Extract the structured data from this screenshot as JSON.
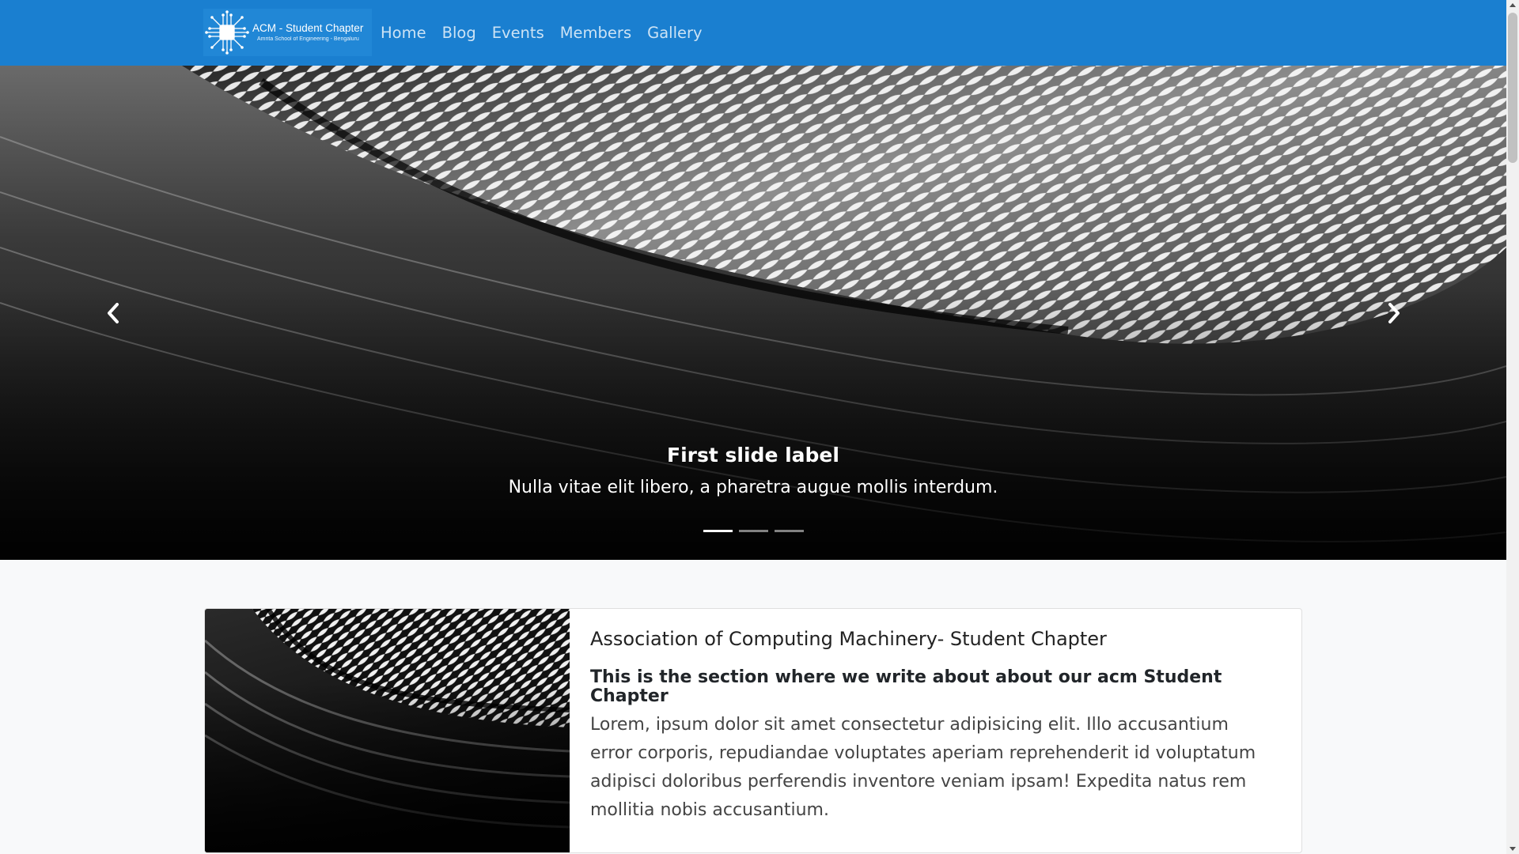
{
  "navbar": {
    "brand_title": "ACM - Student Chapter",
    "brand_subtitle": "Amrita School of Engineering - Bengaluru",
    "links": [
      "Home",
      "Blog",
      "Events",
      "Members",
      "Gallery"
    ],
    "bg_color": "#1a7fd0"
  },
  "carousel": {
    "caption_title": "First slide label",
    "caption_text": "Nulla vitae elit libero, a pharetra augue mollis interdum.",
    "slide_count": 3,
    "active_slide": 1,
    "prev_icon": "chevron-left-icon",
    "next_icon": "chevron-right-icon"
  },
  "about": {
    "title": "Association of Computing Machinery- Student Chapter",
    "subtitle": "This is the section where we write about about our acm Student Chapter",
    "text": "Lorem, ipsum dolor sit amet consectetur adipisicing elit. Illo accusantium error corporis, repudiandae voluptates aperiam reprehenderit id voluptatum adipisci doloribus perferendis inventore veniam ipsam! Expedita natus rem mollitia nobis accusantium."
  }
}
